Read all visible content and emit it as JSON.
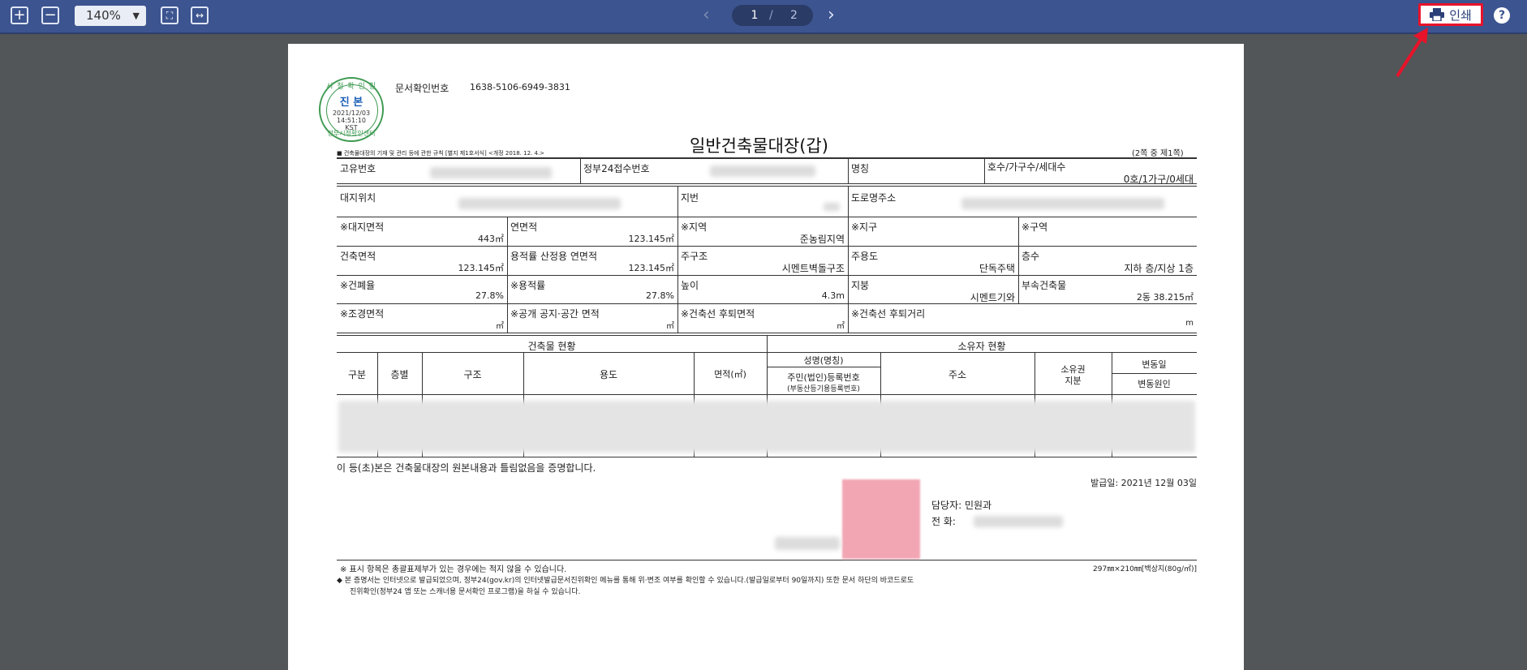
{
  "toolbar": {
    "zoom_in_icon": "plus-square-icon",
    "zoom_out_icon": "minus-square-icon",
    "zoom_level": "140%",
    "fit_page_icon": "fit-page-icon",
    "fit_width_icon": "fit-width-icon",
    "prev_icon": "chevron-left-icon",
    "current_page": "1",
    "page_separator": "/",
    "total_pages": "2",
    "next_icon": "chevron-right-icon",
    "print_label": "인쇄",
    "help_label": "?"
  },
  "colors": {
    "toolbar_bg": "#3c548f",
    "viewer_bg": "#525659",
    "highlight_red": "#e8132a",
    "stamp_green": "#3e9a52"
  },
  "document": {
    "doc_confirm_label": "문서확인번호",
    "doc_confirm_number": "1638-5106-6949-3831",
    "stamp": {
      "top": "시 청 확 인 필",
      "main": "진 본",
      "date": "2021/12/03",
      "time": "14:51:10",
      "tz": "KST",
      "bottom": "정부시청확인센터"
    },
    "regulation_note": "■ 건축물대장의 기재 및 관리 등에 관한 규칙 [별지 제1호서식] <개정 2018. 12. 4.>",
    "title": "일반건축물대장(갑)",
    "page_count_label": "(2쪽 중 제1쪽)",
    "row1": {
      "unique_no_label": "고유번호",
      "gov24_label": "정부24접수번호",
      "name_label": "명칭",
      "units_label": "호수/가구수/세대수",
      "units_value": "0호/1가구/0세대"
    },
    "row2": {
      "site_label": "대지위치",
      "lot_label": "지번",
      "road_label": "도로명주소"
    },
    "row3": {
      "site_area_label": "※대지면적",
      "site_area_value": "443㎡",
      "total_floor_label": "연면적",
      "total_floor_value": "123.145㎡",
      "zone_label": "※지역",
      "zone_value": "준농림지역",
      "district_label": "※지구",
      "area_label": "※구역"
    },
    "row4": {
      "building_area_label": "건축면적",
      "building_area_value": "123.145㎡",
      "far_floor_label": "용적률 산정용 연면적",
      "far_floor_value": "123.145㎡",
      "structure_label": "주구조",
      "structure_value": "시멘트벽돌구조",
      "use_label": "주용도",
      "use_value": "단독주택",
      "floors_label": "층수",
      "floors_value": "지하   층/지상  1층"
    },
    "row5": {
      "bcr_label": "※건폐율",
      "bcr_value": "27.8%",
      "far_label": "※용적률",
      "far_value": "27.8%",
      "height_label": "높이",
      "height_value": "4.3m",
      "roof_label": "지붕",
      "roof_value": "시멘트기와",
      "annex_label": "부속건축물",
      "annex_value": "2동 38.215㎡"
    },
    "row6": {
      "landscape_label": "※조경면적",
      "landscape_unit": "㎡",
      "public_label": "※공개 공지·공간 면적",
      "public_unit": "㎡",
      "setback_area_label": "※건축선 후퇴면적",
      "setback_area_unit": "㎡",
      "setback_dist_label": "※건축선 후퇴거리",
      "setback_dist_unit": "m"
    },
    "building_status_header": "건축물 현황",
    "owner_status_header": "소유자 현황",
    "columns": {
      "division": "구분",
      "floor": "층별",
      "structure": "구조",
      "use": "용도",
      "area": "면적(㎡)",
      "owner_name": "성명(명칭)",
      "owner_reg": "주민(법인)등록번호",
      "owner_reg2": "(부동산등기용등록번호)",
      "address": "주소",
      "share1": "소유권",
      "share2": "지분",
      "change_date": "변동일",
      "change_reason": "변동원인"
    },
    "certify_text": "이 등(초)본은 건축물대장의 원본내용과 틀림없음을 증명합니다.",
    "issue_date": "발급일: 2021년 12월 03일",
    "contact_label": "담당자: 민원과",
    "phone_label": "전   화:",
    "footnote1": "※ 표시 항목은 총괄표제부가 있는 경우에는 적지 않을 수 있습니다.",
    "paper_size": "297㎜×210㎜[백상지(80g/㎡)]",
    "footnote2": "◆ 본 증명서는 인터넷으로 발급되었으며, 정부24(gov.kr)의 인터넷발급문서진위확인 메뉴를 통해 위·변조 여부를 확인할 수 있습니다.(발급일로부터 90일까지) 또한 문서 하단의 바코드로도",
    "footnote3": "진위확인(정부24 앱 또는 스캐너용 문서확인 프로그램)을 하실 수 있습니다."
  }
}
